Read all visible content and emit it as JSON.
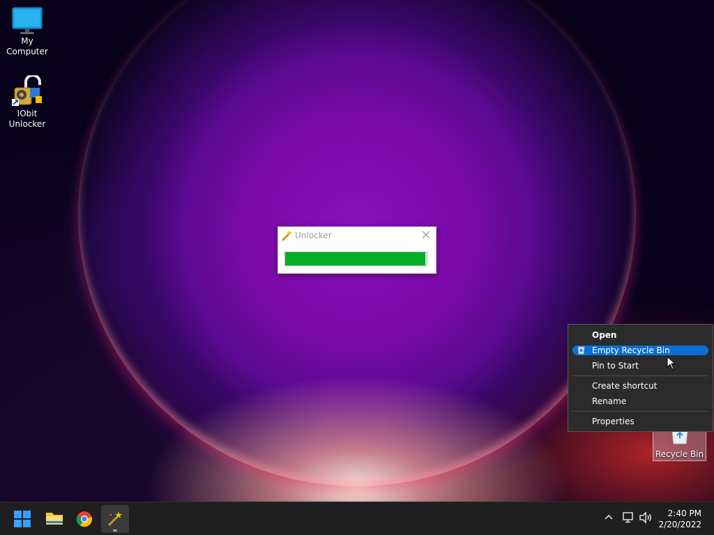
{
  "desktop": {
    "icons": [
      {
        "label": "My Computer",
        "icon": "monitor-icon"
      },
      {
        "label": "IObit Unlocker",
        "icon": "padlock-icon"
      },
      {
        "label": "Recycle Bin",
        "icon": "recycle-bin-icon"
      }
    ]
  },
  "unlocker": {
    "title": "Unlocker",
    "progress_percent": 99
  },
  "context_menu": {
    "items": [
      {
        "label": "Open",
        "bold": true
      },
      {
        "label": "Empty Recycle Bin",
        "highlighted": true
      },
      {
        "label": "Pin to Start"
      },
      {
        "label": "Create shortcut"
      },
      {
        "label": "Rename"
      },
      {
        "label": "Properties"
      }
    ]
  },
  "taskbar": {
    "apps": [
      "start-icon",
      "file-explorer-icon",
      "chrome-icon",
      "unlocker-wand-icon"
    ],
    "time": "2:40 PM",
    "date": "2/20/2022"
  },
  "colors": {
    "progress": "#06b025",
    "menu_highlight": "#0a6fd4",
    "menu_bg": "#2b2b2b",
    "taskbar_bg": "#1f1f1f"
  }
}
